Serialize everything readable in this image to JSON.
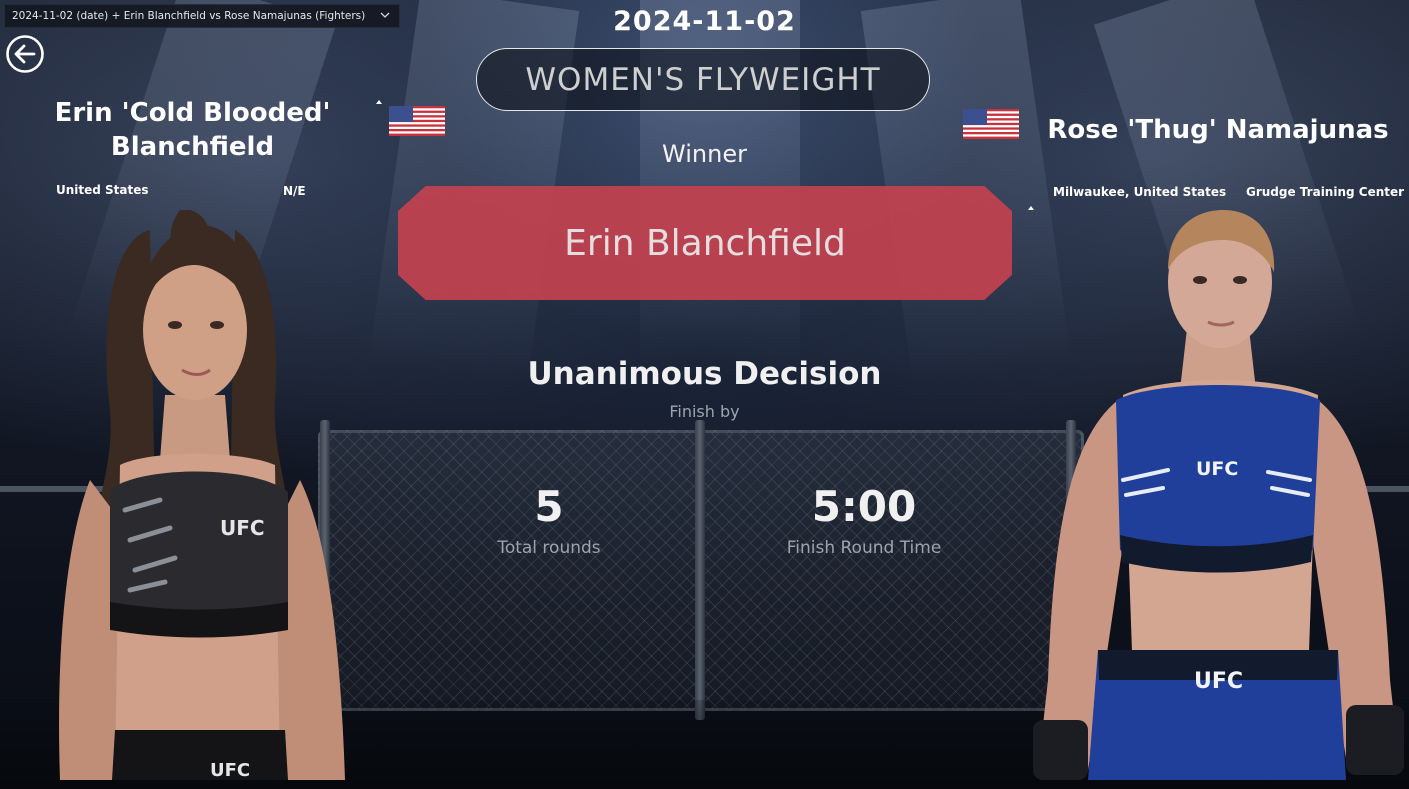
{
  "filter": {
    "value": "2024-11-02 (date) + Erin Blanchfield vs Rose Namajunas (Fighters)"
  },
  "event": {
    "date": "2024-11-02",
    "weight_class": "WOMEN'S FLYWEIGHT"
  },
  "result": {
    "winner_label": "Winner",
    "winner_name": "Erin Blanchfield",
    "method": "Unanimous Decision",
    "method_caption": "Finish by",
    "total_rounds": "5",
    "total_rounds_label": "Total rounds",
    "finish_time": "5:00",
    "finish_time_label": "Finish Round Time"
  },
  "fighter_left": {
    "name_line1": "Erin 'Cold Blooded'",
    "name_line2": "Blanchfield",
    "hometown": "United States",
    "team": "N/E",
    "flag": "us-flag-icon",
    "trunks_text": "UFC"
  },
  "fighter_right": {
    "name": "Rose 'Thug' Namajunas",
    "hometown": "Milwaukee, United States",
    "team": "Grudge Training Center",
    "flag": "us-flag-icon",
    "top_text": "UFC",
    "shorts_text": "UFC"
  },
  "colors": {
    "winner_banner": "#c2424f",
    "background": "#141a28"
  }
}
